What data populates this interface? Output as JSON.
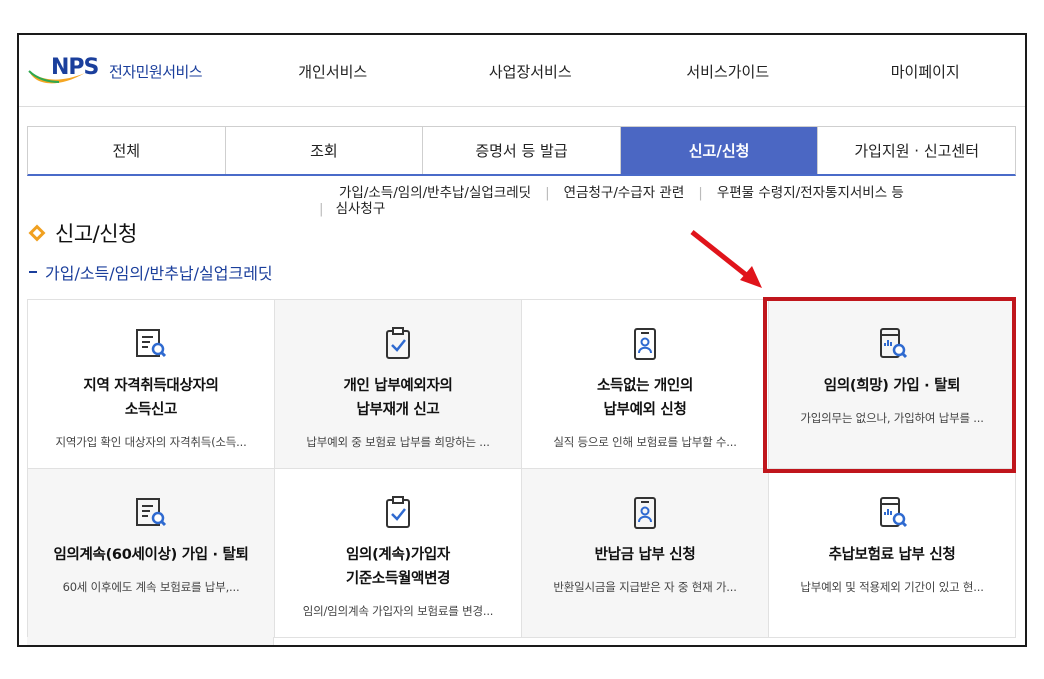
{
  "header": {
    "logo": {
      "mark": "NPS",
      "text": "전자민원서비스"
    },
    "gnb": [
      "개인서비스",
      "사업장서비스",
      "서비스가이드",
      "마이페이지"
    ]
  },
  "tabs": [
    {
      "label": "전체",
      "active": false
    },
    {
      "label": "조회",
      "active": false
    },
    {
      "label": "증명서 등 발급",
      "active": false
    },
    {
      "label": "신고/신청",
      "active": true
    },
    {
      "label": "가입지원 · 신고센터",
      "active": false
    }
  ],
  "submenu": {
    "items": [
      "가입/소득/임의/반추납/실업크레딧",
      "연금청구/수급자 관련",
      "우편물 수령지/전자통지서비스 등",
      "심사청구"
    ]
  },
  "section": {
    "title": "신고/신청",
    "subtitle": "가입/소득/임의/반추납/실업크레딧"
  },
  "cards": [
    {
      "title": "지역 자격취득대상자의\n소득신고",
      "desc": "지역가입 확인 대상자의 자격취득(소득...",
      "icon": "document-search-icon",
      "bg": "white"
    },
    {
      "title": "개인 납부예외자의\n납부재개 신고",
      "desc": "납부예외 중 보험료 납부를 희망하는 ...",
      "icon": "clipboard-check-icon",
      "bg": "gray"
    },
    {
      "title": "소득없는 개인의\n납부예외 신청",
      "desc": "실직 등으로 인해 보험료를 납부할 수...",
      "icon": "person-card-icon",
      "bg": "white"
    },
    {
      "title": "임의(희망) 가입 · 탈퇴",
      "desc": "가입의무는 없으나, 가입하여 납부를 ...",
      "icon": "phone-search-icon",
      "bg": "gray"
    },
    {
      "title": "임의계속(60세이상) 가입 · 탈퇴",
      "desc": "60세 이후에도 계속 보험료를 납부,...",
      "icon": "document-search-icon",
      "bg": "gray"
    },
    {
      "title": "임의(계속)가입자\n기준소득월액변경",
      "desc": "임의/임의계속 가입자의 보험료를 변경...",
      "icon": "clipboard-check-icon",
      "bg": "white"
    },
    {
      "title": "반납금 납부 신청",
      "desc": "반환일시금을 지급받은 자 중 현재 가...",
      "icon": "person-card-icon",
      "bg": "gray"
    },
    {
      "title": "추납보험료 납부 신청",
      "desc": "납부예외 및 적용제외 기간이 있고 현...",
      "icon": "phone-search-icon",
      "bg": "white"
    }
  ],
  "colors": {
    "brand": "#1b3f9c",
    "active_tab": "#4b67c3",
    "accent_orange": "#f0a020",
    "highlight": "#c0161c"
  }
}
